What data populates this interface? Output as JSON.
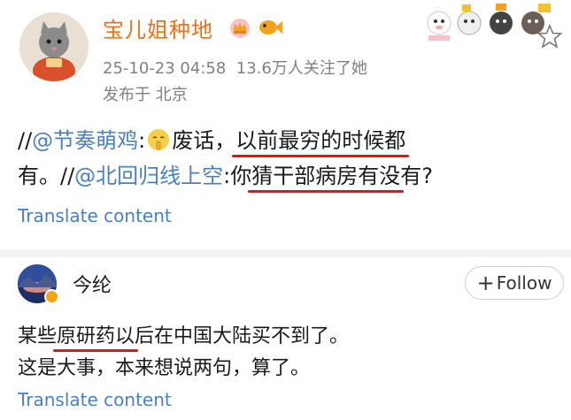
{
  "post1": {
    "author": "宝儿姐种地",
    "time": "25-10-23 04:58",
    "followers": "13.6万人关注了她",
    "location": "发布于 北京",
    "line1": {
      "prefix": "//",
      "mention1": "@节奏萌鸡",
      "colon1": ":",
      "text_a": "废话，",
      "text_underlined": "以前最穷的时候都"
    },
    "line2": {
      "text_a": "有。//",
      "mention2": "@北回归线上空",
      "text_b": ":你",
      "text_underlined": "猜干部病房有没",
      "text_c": "有?"
    },
    "translate": "Translate content"
  },
  "post2": {
    "author": "今纶",
    "follow_label": "Follow",
    "line1": {
      "text_a": "某些",
      "text_underlined": "原研药以",
      "text_b": "后在中国大陆买不到了。"
    },
    "line2": "这是大事，本来想说两句，算了。",
    "translate": "Translate content"
  },
  "icons": {
    "avatar1": "cat-avatar",
    "crown": "crown-badge-icon",
    "fish": "fish-badge-icon",
    "stickers": "cat-stickers",
    "star": "star-icon",
    "emoji": "shh-emoji-icon",
    "verified": "verified-badge-icon"
  },
  "colors": {
    "author_name": "#e8711a",
    "link": "#4a7fc0",
    "underline": "#e01616",
    "meta": "#808080"
  }
}
